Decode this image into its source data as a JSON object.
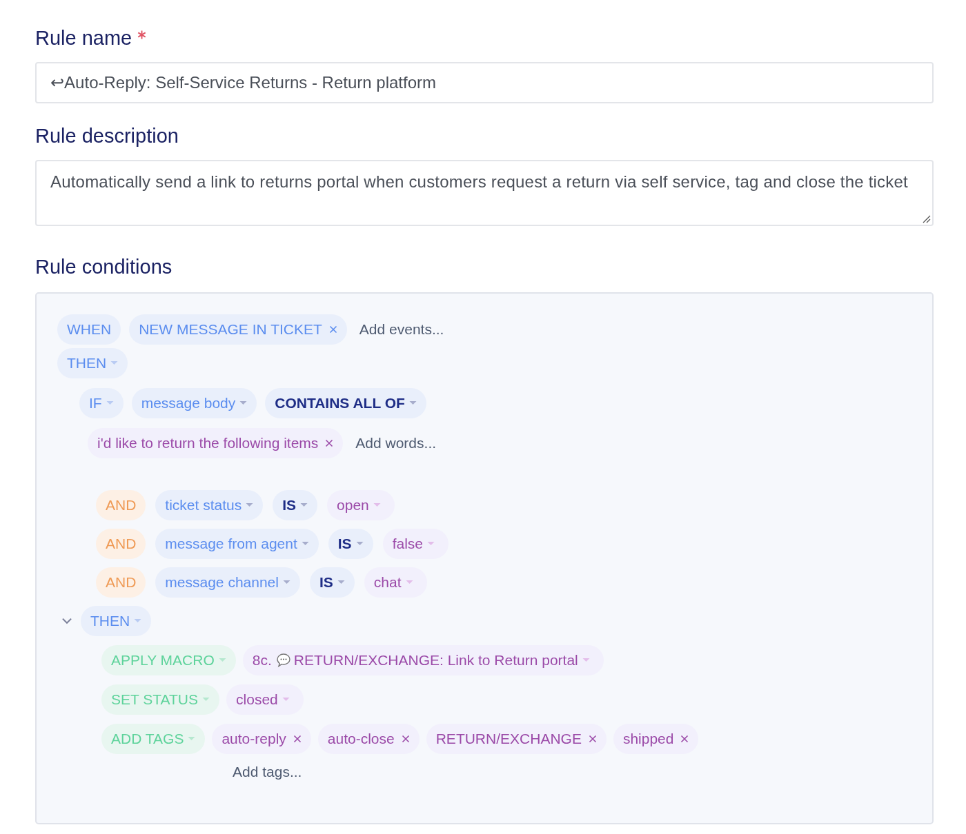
{
  "rule_name": {
    "label": "Rule name",
    "required": true,
    "value": "↩Auto-Reply: Self-Service Returns - Return platform"
  },
  "rule_description": {
    "label": "Rule description",
    "value": "Automatically send a link to returns portal when customers request a return via self service, tag and close the ticket"
  },
  "rule_conditions": {
    "label": "Rule conditions",
    "trigger": {
      "keyword": "WHEN",
      "events": [
        "NEW MESSAGE IN TICKET"
      ],
      "add_placeholder": "Add events..."
    },
    "then": {
      "keyword": "THEN"
    },
    "if": {
      "keyword": "IF",
      "field": "message body",
      "operator": "CONTAINS ALL OF",
      "words": [
        "i'd like to return the following items"
      ],
      "add_placeholder": "Add words..."
    },
    "and_conditions": [
      {
        "keyword": "AND",
        "field": "ticket status",
        "operator": "IS",
        "value": "open"
      },
      {
        "keyword": "AND",
        "field": "message from agent",
        "operator": "IS",
        "value": "false"
      },
      {
        "keyword": "AND",
        "field": "message channel",
        "operator": "IS",
        "value": "chat"
      }
    ],
    "actions_block": {
      "keyword": "THEN",
      "expanded": true,
      "actions": [
        {
          "kind": "macro",
          "keyword": "APPLY MACRO",
          "prefix": "8c.",
          "value": "RETURN/EXCHANGE: Link to Return portal"
        },
        {
          "kind": "status",
          "keyword": "SET STATUS",
          "value": "closed"
        },
        {
          "kind": "tags",
          "keyword": "ADD TAGS",
          "tags": [
            "auto-reply",
            "auto-close",
            "RETURN/EXCHANGE",
            "shipped"
          ],
          "add_placeholder": "Add tags..."
        }
      ]
    }
  }
}
